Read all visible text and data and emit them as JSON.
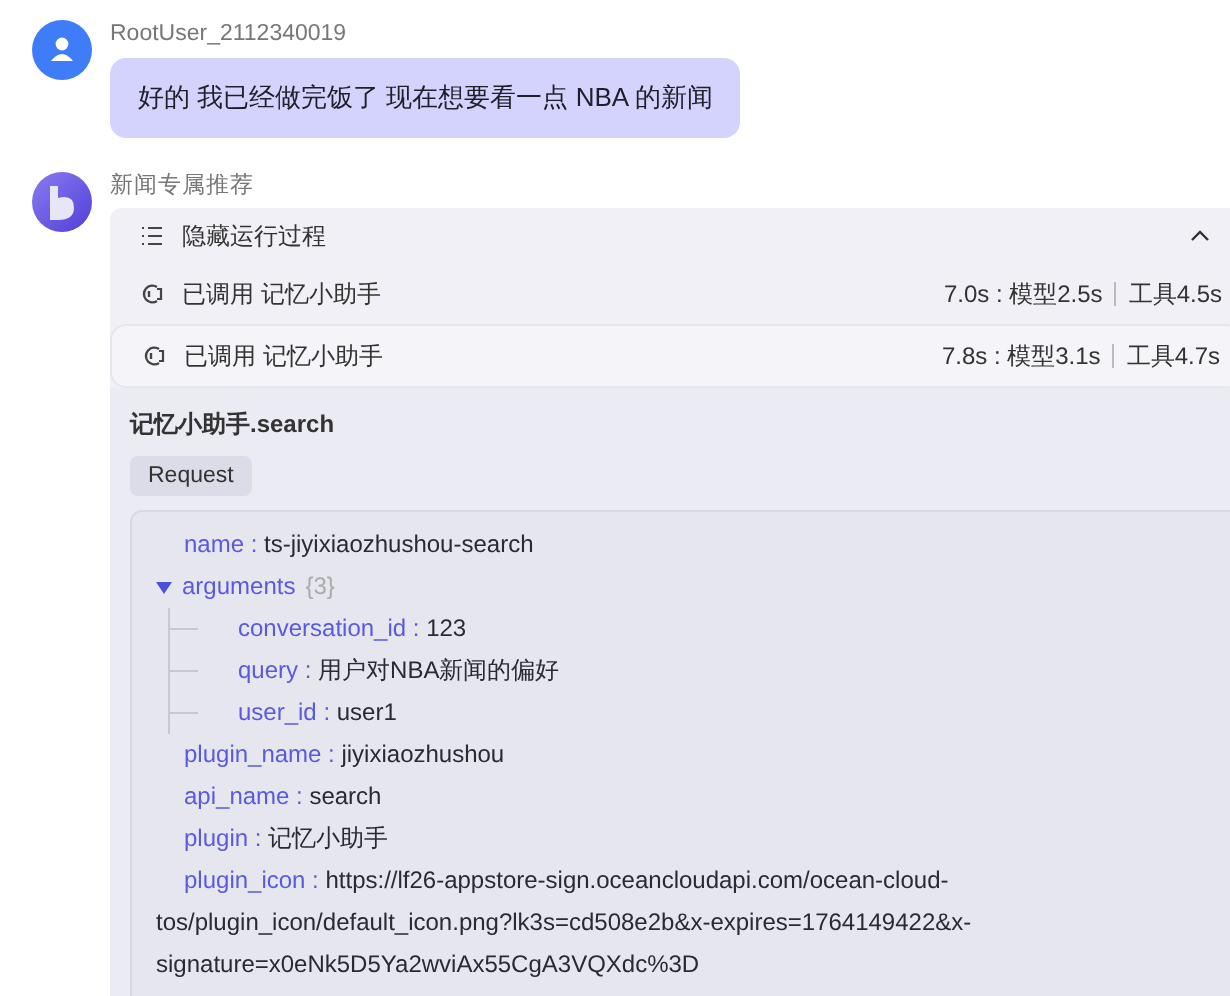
{
  "user_message": {
    "username": "RootUser_2112340019",
    "text": "好的 我已经做完饭了 现在想要看一点 NBA 的新闻"
  },
  "bot_message": {
    "bot_name": "新闻专属推荐",
    "process": {
      "label": "隐藏运行过程",
      "expanded": true,
      "calls": [
        {
          "label": "已调用 记忆小助手",
          "timing": "7.0s : 模型2.5s",
          "tool_time": "工具4.5s",
          "expanded": false
        },
        {
          "label": "已调用 记忆小助手",
          "timing": "7.8s : 模型3.1s",
          "tool_time": "工具4.7s",
          "expanded": true,
          "detail": {
            "title": "记忆小助手.search",
            "tab": "Request",
            "fields": [
              {
                "key": "name :",
                "value": "ts-jiyixiaozhushou-search"
              },
              {
                "key": "arguments",
                "count": "{3}",
                "expanded": true,
                "children": [
                  {
                    "key": "conversation_id :",
                    "value": "123"
                  },
                  {
                    "key": "query :",
                    "value": "用户对NBA新闻的偏好"
                  },
                  {
                    "key": "user_id :",
                    "value": "user1"
                  }
                ]
              },
              {
                "key": "plugin_name :",
                "value": "jiyixiaozhushou"
              },
              {
                "key": "api_name :",
                "value": "search"
              },
              {
                "key": "plugin :",
                "value": "记忆小助手"
              },
              {
                "key": "plugin_icon :",
                "value": "https://lf26-appstore-sign.oceancloudapi.com/ocean-cloud-tos/plugin_icon/default_icon.png?lk3s=cd508e2b&x-expires=1764149422&x-signature=x0eNk5D5Ya2wviAx55CgA3VQXdc%3D"
              }
            ]
          }
        }
      ]
    }
  }
}
